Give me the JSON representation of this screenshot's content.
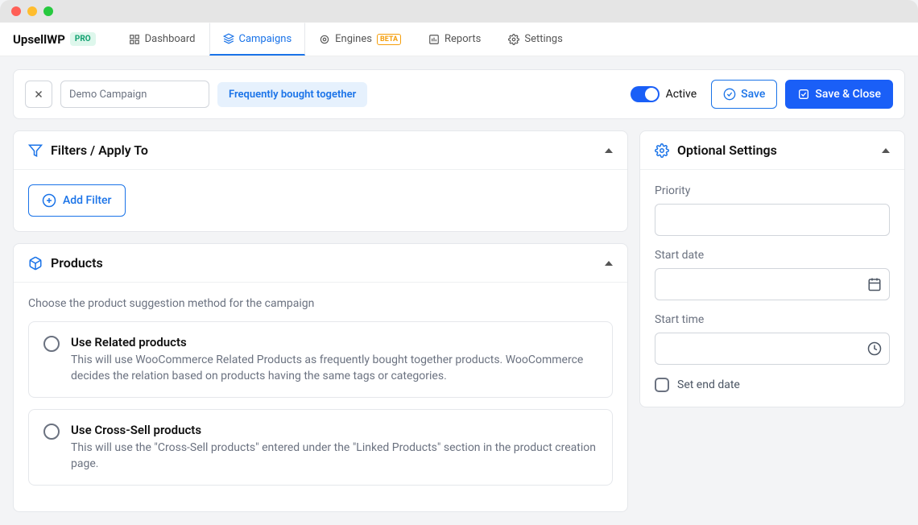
{
  "brand": {
    "name": "UpsellWP",
    "badge": "PRO"
  },
  "tabs": {
    "dashboard": "Dashboard",
    "campaigns": "Campaigns",
    "engines": "Engines",
    "engines_badge": "BETA",
    "reports": "Reports",
    "settings": "Settings"
  },
  "header": {
    "campaign_name": "Demo Campaign",
    "type_badge": "Frequently bought together",
    "active_label": "Active",
    "save_label": "Save",
    "save_close_label": "Save & Close"
  },
  "filters": {
    "title": "Filters / Apply To",
    "add_filter_label": "Add Filter"
  },
  "products": {
    "title": "Products",
    "helper": "Choose the product suggestion method for the campaign",
    "options": [
      {
        "title": "Use Related products",
        "desc": "This will use WooCommerce Related Products as frequently bought together products. WooCommerce decides the relation based on products having the same tags or categories."
      },
      {
        "title": "Use Cross-Sell products",
        "desc": "This will use the \"Cross-Sell products\" entered under the \"Linked Products\" section in the product creation page."
      }
    ]
  },
  "optional": {
    "title": "Optional Settings",
    "priority_label": "Priority",
    "start_date_label": "Start date",
    "start_time_label": "Start time",
    "set_end_date_label": "Set end date"
  }
}
